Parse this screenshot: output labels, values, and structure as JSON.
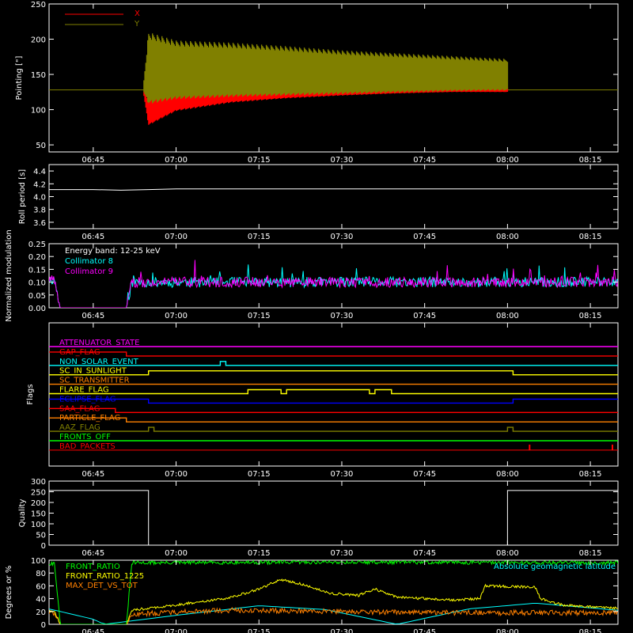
{
  "colors": {
    "background": "#000000",
    "axes": "#ffffff",
    "red": "#ff0000",
    "olive": "#808000",
    "cyan": "#00ffff",
    "magenta": "#ff00ff",
    "yellow": "#ffff00",
    "green": "#00ff00",
    "orange": "#ff8000",
    "blue": "#0000ff",
    "flag_attenuator": "#ff00ff",
    "flag_gap": "#ff0000",
    "flag_non_solar": "#00ffff",
    "flag_sunlight": "#ffff00",
    "flag_transmitter": "#ff8000",
    "flag_flare": "#ffff00",
    "flag_eclipse": "#0000ff",
    "flag_saa": "#ff0000",
    "flag_particle": "#ff8000",
    "flag_aaz": "#808000",
    "flag_fronts_off": "#00ff00",
    "flag_bad_packets": "#ff0000"
  },
  "chart_data": [
    {
      "type": "line",
      "ylabel": "Pointing [\"]",
      "xlim": [
        "06:37",
        "08:20"
      ],
      "ylim": [
        40,
        250
      ],
      "yticks": [
        "50",
        "100",
        "150",
        "200",
        "250"
      ],
      "xticks": [
        "06:45",
        "07:00",
        "07:15",
        "07:30",
        "07:45",
        "08:00",
        "08:15"
      ],
      "legend": [
        "X",
        "Y"
      ],
      "baseline": 128,
      "series": [
        {
          "name": "X",
          "x": [
            "06:54",
            "06:55",
            "07:00",
            "07:10",
            "07:20",
            "07:30",
            "07:40",
            "07:50",
            "08:00"
          ],
          "low": [
            128,
            78,
            98,
            110,
            116,
            120,
            123,
            125,
            125
          ],
          "high": [
            128,
            115,
            140,
            145,
            143,
            139,
            136,
            134,
            132
          ]
        },
        {
          "name": "Y",
          "x": [
            "06:54",
            "06:55",
            "07:00",
            "07:10",
            "07:20",
            "07:30",
            "07:40",
            "07:50",
            "08:00"
          ],
          "low": [
            128,
            108,
            115,
            118,
            120,
            122,
            124,
            126,
            127
          ],
          "high": [
            128,
            210,
            198,
            195,
            190,
            184,
            180,
            176,
            172
          ]
        }
      ]
    },
    {
      "type": "line",
      "ylabel": "Roll period [s]",
      "ylim": [
        3.5,
        4.5
      ],
      "yticks": [
        "3.6",
        "3.8",
        "4.0",
        "4.2",
        "4.4"
      ],
      "xticks": [
        "06:45",
        "07:00",
        "07:15",
        "07:30",
        "07:45",
        "08:00",
        "08:15"
      ],
      "series": [
        {
          "x": [
            "06:37",
            "06:45",
            "06:50",
            "06:55",
            "07:00",
            "07:10",
            "07:20",
            "07:40",
            "08:00",
            "08:20"
          ],
          "values": [
            4.11,
            4.11,
            4.1,
            4.11,
            4.12,
            4.12,
            4.12,
            4.12,
            4.12,
            4.12
          ]
        }
      ]
    },
    {
      "type": "line",
      "ylabel": "Normalized modulation",
      "ylim": [
        0,
        0.25
      ],
      "yticks": [
        "0.00",
        "0.05",
        "0.10",
        "0.15",
        "0.20",
        "0.25"
      ],
      "xticks": [
        "06:45",
        "07:00",
        "07:15",
        "07:30",
        "07:45",
        "08:00",
        "08:15"
      ],
      "annotation": "Energy band: 12-25 keV",
      "series": [
        {
          "name": "Collimator 8",
          "x": [
            "06:37",
            "06:38",
            "06:39",
            "06:51",
            "06:52",
            "07:30",
            "08:20"
          ],
          "values": [
            0.11,
            0.11,
            0.0,
            0.0,
            0.1,
            0.1,
            0.1
          ]
        },
        {
          "name": "Collimator 9",
          "x": [
            "06:37",
            "06:38",
            "06:39",
            "06:51",
            "06:52",
            "07:30",
            "08:20"
          ],
          "values": [
            0.11,
            0.11,
            0.0,
            0.0,
            0.1,
            0.1,
            0.1
          ]
        }
      ]
    },
    {
      "type": "line",
      "ylabel": "Flags",
      "xticks": [
        "06:45",
        "07:00",
        "07:15",
        "07:30",
        "07:45",
        "08:00",
        "08:15"
      ],
      "flags": [
        {
          "name": "ATTENUATOR_STATE",
          "segments": [
            [
              "06:37",
              "08:20",
              0
            ]
          ]
        },
        {
          "name": "GAP_FLAG",
          "segments": [
            [
              "06:37",
              "06:51",
              1
            ],
            [
              "06:51",
              "08:20",
              0
            ]
          ]
        },
        {
          "name": "NON_SOLAR_EVENT",
          "segments": [
            [
              "06:37",
              "07:08",
              0
            ],
            [
              "07:08",
              "07:09",
              1
            ],
            [
              "07:09",
              "08:20",
              0
            ]
          ]
        },
        {
          "name": "SC_IN_SUNLIGHT",
          "segments": [
            [
              "06:37",
              "06:55",
              0
            ],
            [
              "06:55",
              "08:01",
              1
            ],
            [
              "08:01",
              "08:20",
              0
            ]
          ]
        },
        {
          "name": "SC_TRANSMITTER",
          "segments": [
            [
              "06:37",
              "08:20",
              0
            ]
          ]
        },
        {
          "name": "FLARE_FLAG",
          "segments": [
            [
              "06:37",
              "07:13",
              0
            ],
            [
              "07:13",
              "07:19",
              1
            ],
            [
              "07:19",
              "07:20",
              0
            ],
            [
              "07:20",
              "07:35",
              1
            ],
            [
              "07:35",
              "07:36",
              0
            ],
            [
              "07:36",
              "07:39",
              1
            ],
            [
              "07:39",
              "08:20",
              0
            ]
          ]
        },
        {
          "name": "ECLIPSE_FLAG",
          "segments": [
            [
              "06:37",
              "06:55",
              1
            ],
            [
              "06:55",
              "08:01",
              0
            ],
            [
              "08:01",
              "08:20",
              1
            ]
          ]
        },
        {
          "name": "SAA_FLAG",
          "segments": [
            [
              "06:37",
              "06:49",
              1
            ],
            [
              "06:49",
              "08:20",
              0
            ]
          ]
        },
        {
          "name": "PARTICLE_FLAG",
          "segments": [
            [
              "06:37",
              "06:51",
              1
            ],
            [
              "06:51",
              "08:20",
              0
            ]
          ]
        },
        {
          "name": "AAZ_FLAG",
          "segments": [
            [
              "06:37",
              "06:55",
              0
            ],
            [
              "06:55",
              "06:56",
              1
            ],
            [
              "06:56",
              "08:00",
              0
            ],
            [
              "08:00",
              "08:01",
              1
            ],
            [
              "08:01",
              "08:20",
              0
            ]
          ]
        },
        {
          "name": "FRONTS_OFF",
          "segments": [
            [
              "06:37",
              "08:20",
              0
            ]
          ]
        },
        {
          "name": "BAD_PACKETS",
          "segments": [
            [
              "06:37",
              "08:04",
              0
            ],
            [
              "08:04",
              "08:04",
              1
            ],
            [
              "08:04",
              "08:19",
              0
            ],
            [
              "08:19",
              "08:19",
              1
            ],
            [
              "08:19",
              "08:20",
              0
            ]
          ]
        }
      ]
    },
    {
      "type": "line",
      "ylabel": "Quality",
      "ylim": [
        0,
        300
      ],
      "yticks": [
        "0",
        "50",
        "100",
        "150",
        "200",
        "250",
        "300"
      ],
      "xticks": [
        "06:45",
        "07:00",
        "07:15",
        "07:30",
        "07:45",
        "08:00",
        "08:15"
      ],
      "series": [
        {
          "x": [
            "06:37",
            "06:55",
            "06:55",
            "08:00",
            "08:00",
            "08:20"
          ],
          "values": [
            256,
            256,
            0,
            0,
            256,
            256
          ]
        }
      ]
    },
    {
      "type": "line",
      "ylabel": "Degrees or %",
      "ylim": [
        0,
        100
      ],
      "yticks": [
        "0",
        "20",
        "40",
        "60",
        "80",
        "100"
      ],
      "xticks": [
        "06:45",
        "07:00",
        "07:15",
        "07:30",
        "07:45",
        "08:00",
        "08:15"
      ],
      "annotation": "Absolute geomagnetic latitude",
      "series": [
        {
          "name": "FRONT_RATIO",
          "x": [
            "06:37",
            "06:38",
            "06:39",
            "06:51",
            "06:52",
            "07:30",
            "08:20"
          ],
          "values": [
            95,
            95,
            0,
            0,
            96,
            97,
            96
          ]
        },
        {
          "name": "FRONT_RATIO_1225",
          "x": [
            "06:37",
            "06:38",
            "06:39",
            "06:51",
            "06:52",
            "07:00",
            "07:10",
            "07:15",
            "07:19",
            "07:23",
            "07:28",
            "07:33",
            "07:36",
            "07:40",
            "07:50",
            "07:55",
            "07:56",
            "08:05",
            "08:06",
            "08:10",
            "08:20"
          ],
          "values": [
            20,
            20,
            0,
            0,
            22,
            30,
            42,
            55,
            70,
            62,
            48,
            45,
            55,
            42,
            38,
            40,
            60,
            58,
            40,
            30,
            25
          ]
        },
        {
          "name": "MAX_DET_VS_TOT",
          "x": [
            "06:37",
            "06:38",
            "06:39",
            "06:51",
            "06:52",
            "07:10",
            "07:30",
            "07:50",
            "08:10",
            "08:20"
          ],
          "values": [
            18,
            18,
            0,
            0,
            16,
            22,
            20,
            18,
            18,
            18
          ]
        },
        {
          "name": "Absolute geomagnetic latitude",
          "x": [
            "06:37",
            "06:45",
            "06:47",
            "07:00",
            "07:15",
            "07:27",
            "07:40",
            "07:53",
            "08:05",
            "08:20"
          ],
          "values": [
            24,
            8,
            0,
            14,
            29,
            23,
            0,
            24,
            33,
            22
          ]
        }
      ]
    }
  ]
}
